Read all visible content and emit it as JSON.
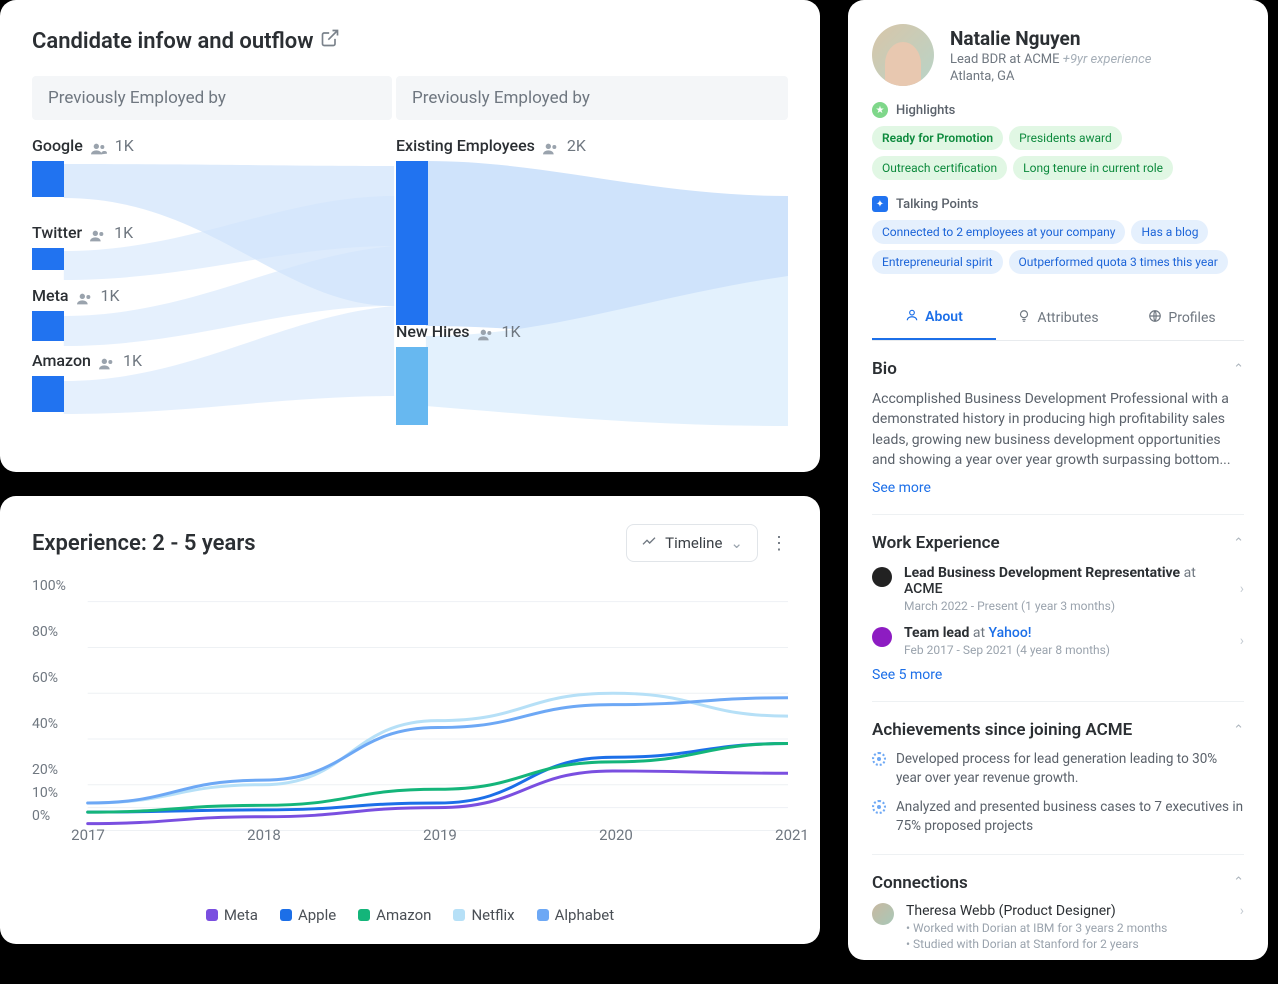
{
  "sankey": {
    "title": "Candidate infow and outflow",
    "header_left": "Previously Employed by",
    "header_right": "Previously Employed by",
    "sources": [
      {
        "name": "Google",
        "count": "1K"
      },
      {
        "name": "Twitter",
        "count": "1K"
      },
      {
        "name": "Meta",
        "count": "1K"
      },
      {
        "name": "Amazon",
        "count": "1K"
      }
    ],
    "destinations": [
      {
        "name": "Existing Employees",
        "count": "2K"
      },
      {
        "name": "New Hires",
        "count": "1K"
      }
    ]
  },
  "line_card": {
    "title": "Experience: 2 - 5 years",
    "dropdown_label": "Timeline"
  },
  "chart_data": {
    "type": "line",
    "title": "Experience: 2 - 5 years",
    "xlabel": "",
    "ylabel": "",
    "ylim": [
      0,
      100
    ],
    "yformat": "percent",
    "x": [
      2017,
      2018,
      2019,
      2020,
      2021
    ],
    "series": [
      {
        "name": "Meta",
        "color": "#7a4fe0",
        "values": [
          3,
          6,
          10,
          26,
          25
        ]
      },
      {
        "name": "Apple",
        "color": "#1c6fe8",
        "values": [
          8,
          9,
          12,
          32,
          38
        ]
      },
      {
        "name": "Amazon",
        "color": "#14b57a",
        "values": [
          8,
          11,
          18,
          30,
          38
        ]
      },
      {
        "name": "Netflix",
        "color": "#b6e0f7",
        "values": [
          12,
          20,
          48,
          60,
          50
        ]
      },
      {
        "name": "Alphabet",
        "color": "#6da8f5",
        "values": [
          12,
          22,
          45,
          55,
          58
        ]
      }
    ],
    "y_ticks": [
      0,
      10,
      20,
      40,
      60,
      80,
      100
    ]
  },
  "profile": {
    "name": "Natalie Nguyen",
    "role_prefix": "Lead BDR at ",
    "company": "ACME",
    "experience": "+9yr experience",
    "location": "Atlanta, GA",
    "highlights_label": "Highlights",
    "highlights": [
      "Ready for Promotion",
      "Presidents award",
      "Outreach certification",
      "Long tenure in current role"
    ],
    "talking_label": "Talking Points",
    "talking_points": [
      "Connected to 2 employees at your company",
      "Has a blog",
      "Entrepreneurial spirit",
      "Outperformed quota 3 times this year"
    ],
    "tabs": {
      "about": "About",
      "attributes": "Attributes",
      "profiles": "Profiles"
    },
    "bio_title": "Bio",
    "bio": "Accomplished Business Development Professional with a demonstrated history in producing high profitability sales leads, growing new business development opportunities and showing a year over year growth surpassing bottom...",
    "see_more": "See more",
    "work_title": "Work Experience",
    "experiences": [
      {
        "role": "Lead Business Development Representative",
        "at": "at",
        "company": "ACME",
        "meta": "March 2022 - Present (1 year 3 months)",
        "logo_bg": "#222",
        "company_color": "#2b2f33"
      },
      {
        "role": "Team lead",
        "at": "at",
        "company": "Yahoo!",
        "meta": "Feb 2017 - Sep 2021 (4 year 8 months)",
        "logo_bg": "#8d1cc2",
        "company_color": "#1c6fe8"
      }
    ],
    "see_5_more": "See 5 more",
    "ach_title": "Achievements since joining ACME",
    "achievements": [
      "Developed process for lead generation leading to 30% year over year revenue growth.",
      "Analyzed and presented business cases to 7 executives in 75% proposed projects"
    ],
    "conn_title": "Connections",
    "connection": {
      "name": "Theresa Webb (Product Designer)",
      "bullets": [
        "• Worked with Dorian at IBM for 3 years 2 months",
        "• Studied with Dorian at Stanford for 2 years"
      ]
    }
  }
}
